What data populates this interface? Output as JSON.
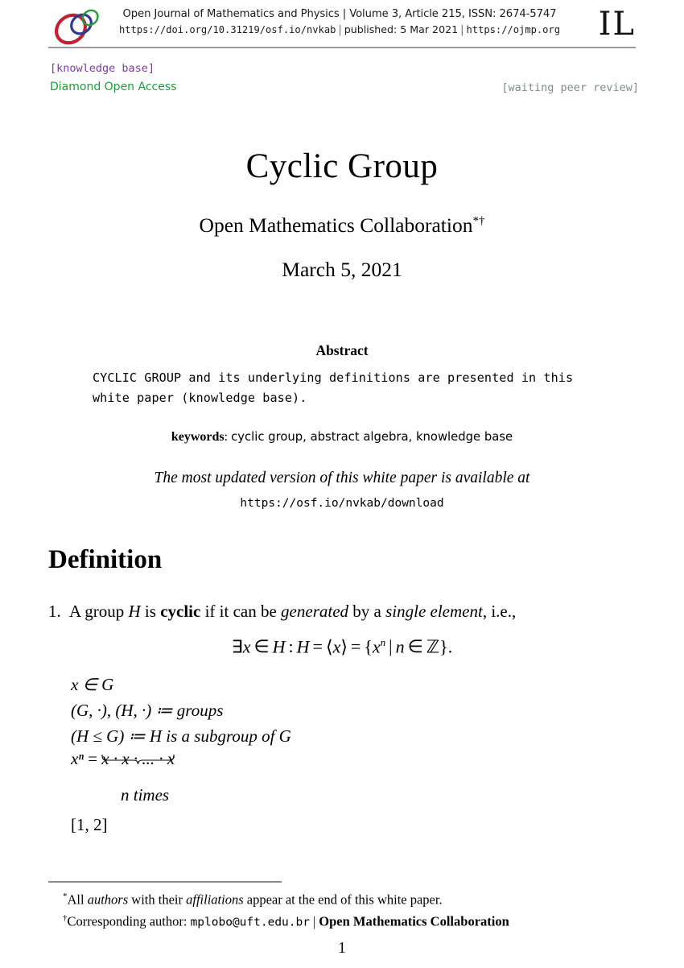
{
  "header": {
    "journal_line": "Open Journal of Mathematics and Physics | Volume 3, Article 215, ISSN: 2674-5747",
    "doi_url": "https://doi.org/10.31219/osf.io/nvkab",
    "published_label": "published: 5 Mar 2021",
    "site_url": "https://ojmp.org",
    "separator": "|",
    "imprint_mark": "IL",
    "logo": {
      "name": "ojmp-rings-logo",
      "ring_colors": [
        "#c32034",
        "#2e3a8c",
        "#1f9c3a"
      ]
    }
  },
  "status": {
    "knowledge_base_tag": "[knowledge base]",
    "open_access_tag": "Diamond Open Access",
    "peer_review_tag": "[waiting peer review]",
    "colors": {
      "knowledge_base": "#7d3c98",
      "open_access": "#1f9c3a",
      "peer_review": "#7f8c8d"
    }
  },
  "title_block": {
    "title": "Cyclic Group",
    "authors": "Open Mathematics Collaboration",
    "author_marks": "*†",
    "date": "March 5, 2021"
  },
  "abstract": {
    "heading": "Abstract",
    "body": "CYCLIC GROUP and its underlying definitions are presented in this white paper (knowledge base).",
    "keywords_label": "keywords",
    "keywords_values": "cyclic group, abstract algebra, knowledge base",
    "updated_note": "The most updated version of this white paper is available at",
    "download_url": "https://osf.io/nvkab/download"
  },
  "definition": {
    "heading": "Definition",
    "item_number": "1.",
    "statement_parts": {
      "p1": "A group",
      "var_h": "H",
      "p2": "is",
      "bold_cyclic": "cyclic",
      "p3": "if it can be",
      "ital_generated": "generated",
      "p4": "by a",
      "ital_single_element": "single element",
      "p5": ", i.e.,"
    },
    "equation": "∃x ∈ H : H = ⟨x⟩ = {xⁿ | n ∈ ℤ}.",
    "equation_tokens": {
      "exists": "∃",
      "x": "x",
      "in1": "∈",
      "h1": "H",
      "colon": ":",
      "h2": "H",
      "eq1": "=",
      "angle_open": "⟨",
      "x2": "x",
      "angle_close": "⟩",
      "eq2": "=",
      "brace_open": "{",
      "x3": "x",
      "sup_n": "n",
      "mid": "|",
      "n": "n",
      "in2": "∈",
      "integers": "ℤ",
      "brace_close": "}",
      "period": "."
    },
    "assumptions": [
      {
        "id": "x-in-G",
        "text": "x ∈ G"
      },
      {
        "id": "groups-def",
        "text": "(G, ·), (H, ·) ≔ groups"
      },
      {
        "id": "subgroup-def",
        "text": "(H ≤ G) ≔ H is a subgroup of G"
      }
    ],
    "power_expansion": {
      "lhs": "xⁿ",
      "equals": "=",
      "rhs": "x · x · ... · x",
      "underbrace_label": "n times"
    },
    "references_inline": "[1, 2]"
  },
  "footnotes": {
    "first_mark": "*",
    "first_text_p1": "All",
    "first_ital1": "authors",
    "first_text_p2": "with their",
    "first_ital2": "affiliations",
    "first_text_p3": "appear at the end of this white paper.",
    "second_mark": "†",
    "second_prefix": "Corresponding author:",
    "second_email": "mplobo@uft.edu.br",
    "second_separator": "|",
    "second_org": "Open Mathematics Collaboration"
  },
  "footer": {
    "page_number": "1"
  }
}
